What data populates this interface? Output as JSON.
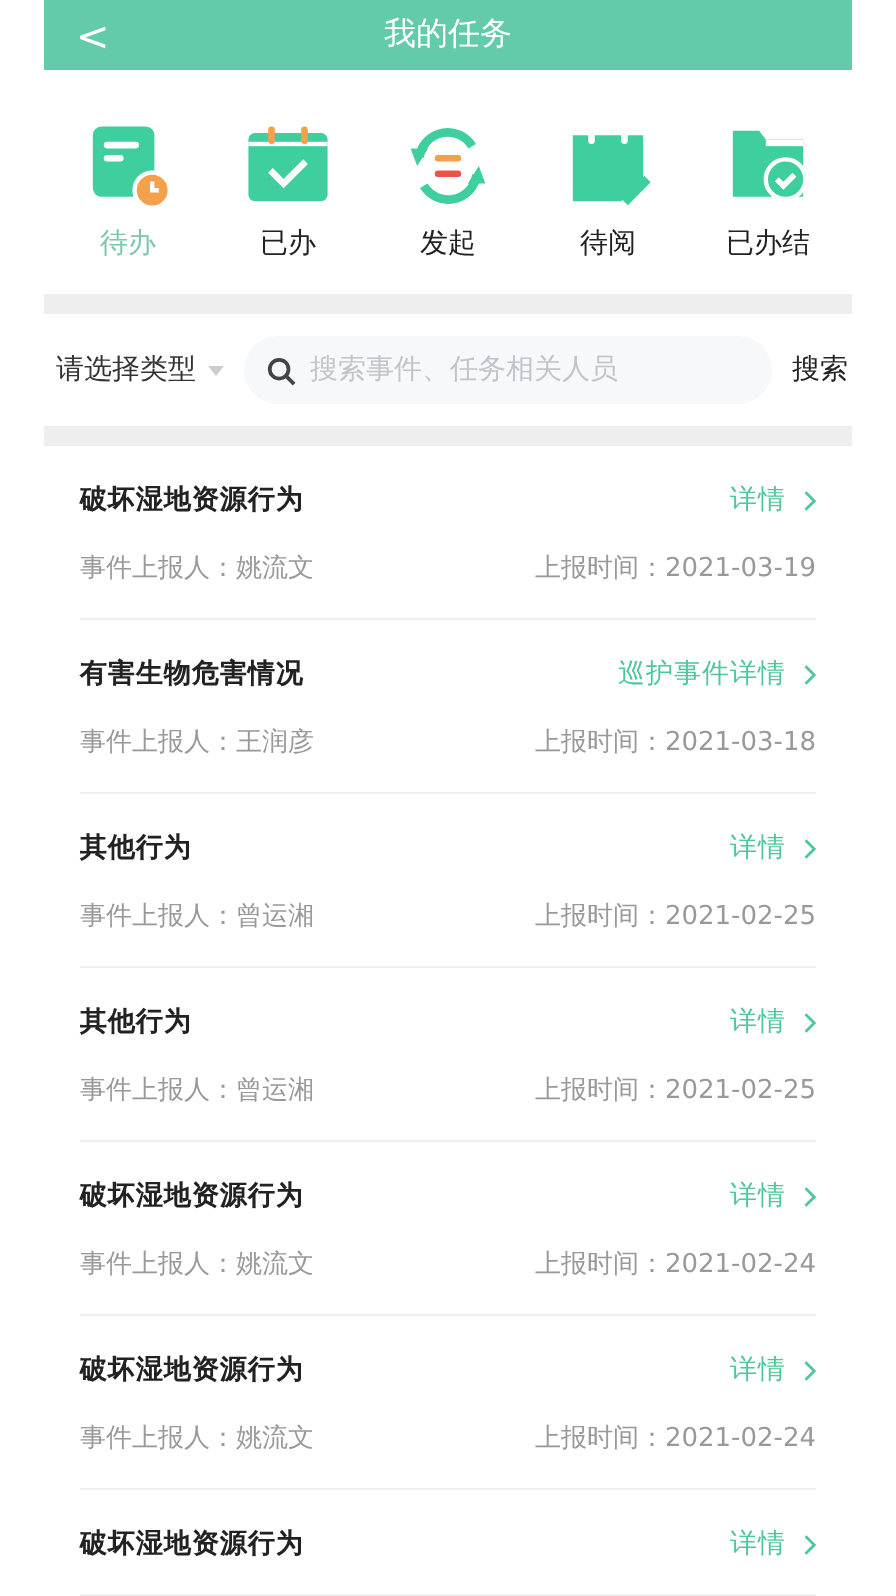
{
  "header": {
    "back": "<",
    "title": "我的任务"
  },
  "categories": [
    {
      "label": "待办",
      "kind": "pending",
      "selected": true
    },
    {
      "label": "已办",
      "kind": "done",
      "selected": false
    },
    {
      "label": "发起",
      "kind": "initiate",
      "selected": false
    },
    {
      "label": "待阅",
      "kind": "toread",
      "selected": false
    },
    {
      "label": "已办结",
      "kind": "closed",
      "selected": false
    }
  ],
  "filter": {
    "type_select": "请选择类型",
    "search": {
      "placeholder": "搜索事件、任务相关人员"
    },
    "search_button": "搜索"
  },
  "tasks": [
    {
      "title": "破坏湿地资源行为",
      "link": "详情",
      "reporter": "事件上报人：姚流文",
      "time": "上报时间：2021-03-19"
    },
    {
      "title": "有害生物危害情况",
      "link": "巡护事件详情",
      "reporter": "事件上报人：王润彦",
      "time": "上报时间：2021-03-18"
    },
    {
      "title": "其他行为",
      "link": "详情",
      "reporter": "事件上报人：曾运湘",
      "time": "上报时间：2021-02-25"
    },
    {
      "title": "其他行为",
      "link": "详情",
      "reporter": "事件上报人：曾运湘",
      "time": "上报时间：2021-02-25"
    },
    {
      "title": "破坏湿地资源行为",
      "link": "详情",
      "reporter": "事件上报人：姚流文",
      "time": "上报时间：2021-02-24"
    },
    {
      "title": "破坏湿地资源行为",
      "link": "详情",
      "reporter": "事件上报人：姚流文",
      "time": "上报时间：2021-02-24"
    },
    {
      "title": "破坏湿地资源行为",
      "link": "详情"
    }
  ]
}
